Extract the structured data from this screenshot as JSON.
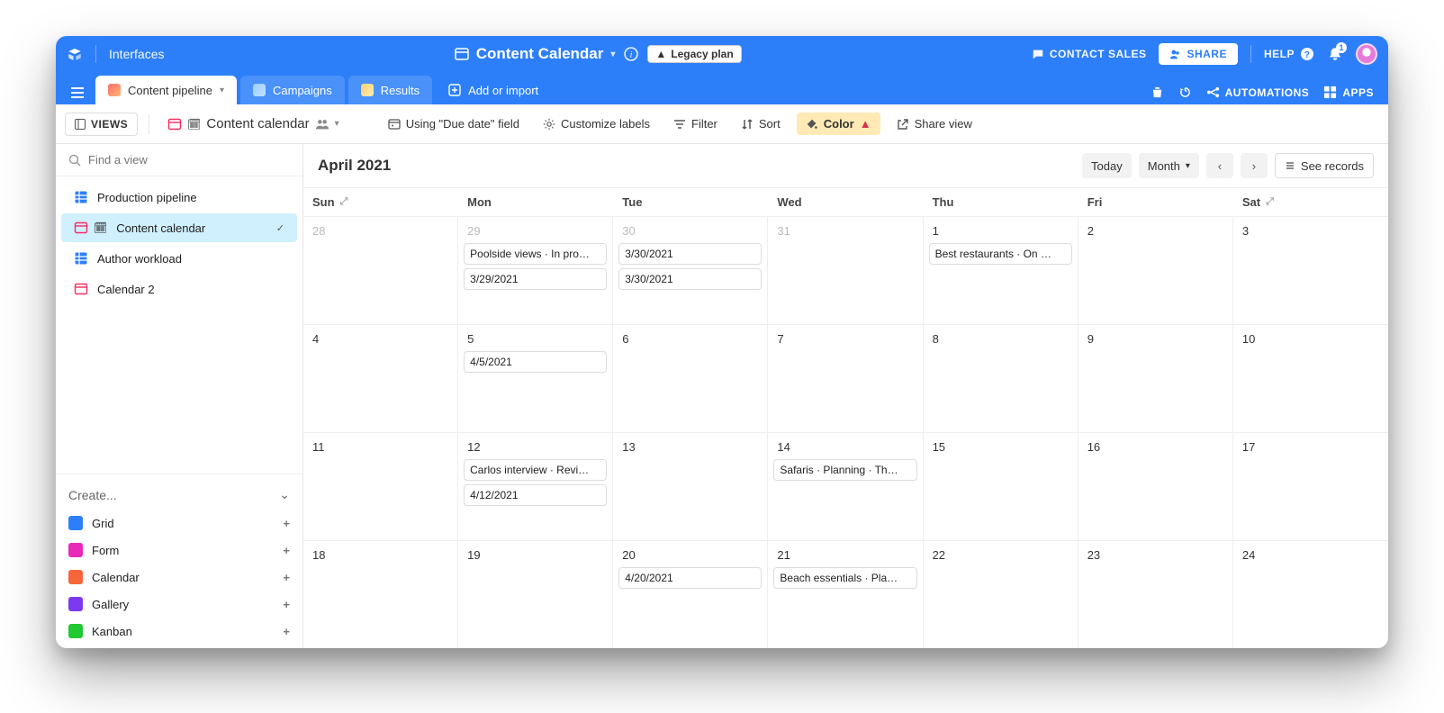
{
  "topbar": {
    "interfaces_label": "Interfaces",
    "base_title": "Content Calendar",
    "legacy_badge": "Legacy plan",
    "contact_sales": "CONTACT SALES",
    "share": "SHARE",
    "help": "HELP",
    "notification_count": "1"
  },
  "tabs": {
    "tab0": "Content pipeline",
    "tab1": "Campaigns",
    "tab2": "Results",
    "add_import": "Add or import",
    "automations": "AUTOMATIONS",
    "apps": "APPS"
  },
  "toolbar": {
    "views": "VIEWS",
    "view_name": "Content calendar",
    "using_field": "Using \"Due date\" field",
    "customize": "Customize labels",
    "filter": "Filter",
    "sort": "Sort",
    "color": "Color",
    "share_view": "Share view"
  },
  "sidebar": {
    "search_placeholder": "Find a view",
    "views": {
      "v0": "Production pipeline",
      "v1": "Content calendar",
      "v2": "Author workload",
      "v3": "Calendar 2"
    },
    "create_label": "Create...",
    "create": {
      "c0": "Grid",
      "c1": "Form",
      "c2": "Calendar",
      "c3": "Gallery",
      "c4": "Kanban"
    }
  },
  "calendar": {
    "title": "April 2021",
    "today": "Today",
    "scale": "Month",
    "see_records": "See records",
    "daynames": {
      "d0": "Sun",
      "d1": "Mon",
      "d2": "Tue",
      "d3": "Wed",
      "d4": "Thu",
      "d5": "Fri",
      "d6": "Sat"
    },
    "cells": {
      "c0_num": "28",
      "c1_num": "29",
      "c2_num": "30",
      "c3_num": "31",
      "c4_num": "1",
      "c5_num": "2",
      "c6_num": "3",
      "c7_num": "4",
      "c8_num": "5",
      "c9_num": "6",
      "c10_num": "7",
      "c11_num": "8",
      "c12_num": "9",
      "c13_num": "10",
      "c14_num": "11",
      "c15_num": "12",
      "c16_num": "13",
      "c17_num": "14",
      "c18_num": "15",
      "c19_num": "16",
      "c20_num": "17",
      "c21_num": "18",
      "c22_num": "19",
      "c23_num": "20",
      "c24_num": "21",
      "c25_num": "22",
      "c26_num": "23",
      "c27_num": "24"
    },
    "events": {
      "e_c1_0": "Poolside views · In pro…",
      "e_c1_1": "3/29/2021",
      "e_c2_0": "3/30/2021",
      "e_c2_1": "3/30/2021",
      "e_c4_0": "Best restaurants · On …",
      "e_c8_0": "4/5/2021",
      "e_c15_0": "Carlos interview · Revi…",
      "e_c15_1": "4/12/2021",
      "e_c17_0": "Safaris · Planning · Th…",
      "e_c23_0": "4/20/2021",
      "e_c24_0": "Beach essentials · Pla…"
    }
  }
}
